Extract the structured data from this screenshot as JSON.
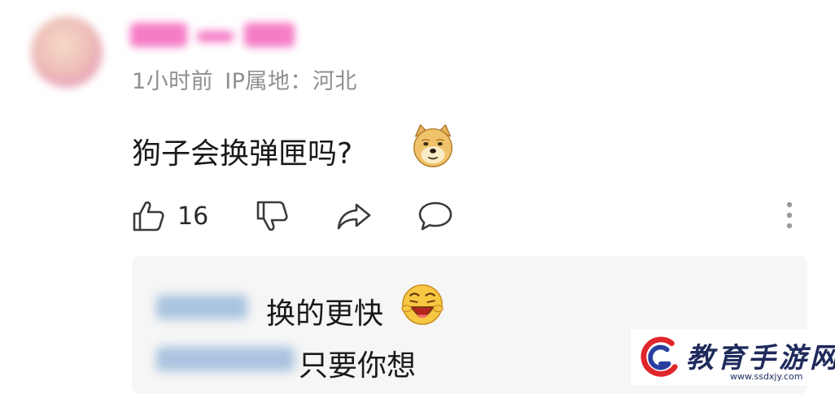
{
  "comment": {
    "meta": {
      "time": "1小时前",
      "ip_label": "IP属地：河北"
    },
    "text": "狗子会换弹匣吗?",
    "emoji": "doge-icon",
    "like_count": "16"
  },
  "replies": [
    {
      "text": "换的更快",
      "emoji": "laughing-emoji-icon"
    },
    {
      "text": "只要你想"
    }
  ],
  "watermark": {
    "title": "教育手游网",
    "url": "www.ssdxjy.com",
    "brand_colors": {
      "red": "#e0252b",
      "blue": "#2a3fa0"
    }
  }
}
